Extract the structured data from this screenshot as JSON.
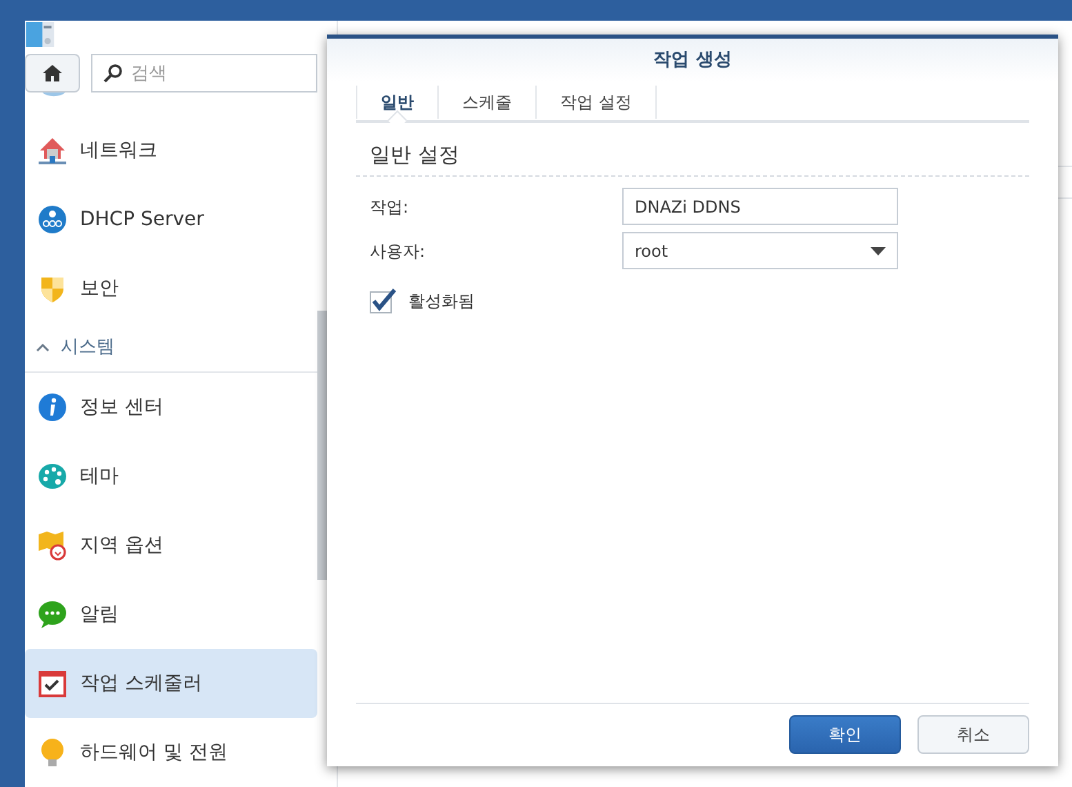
{
  "sidebar": {
    "search": {
      "placeholder": "검색"
    },
    "items": [
      {
        "kind": "item",
        "label": "네트워크",
        "selected": false
      },
      {
        "kind": "item",
        "label": "DHCP Server",
        "selected": false
      },
      {
        "kind": "item",
        "label": "보안",
        "selected": false
      },
      {
        "kind": "section",
        "label": "시스템",
        "expanded": true
      },
      {
        "kind": "item",
        "label": "정보 센터",
        "selected": false
      },
      {
        "kind": "item",
        "label": "테마",
        "selected": false
      },
      {
        "kind": "item",
        "label": "지역 옵션",
        "selected": false
      },
      {
        "kind": "item",
        "label": "알림",
        "selected": false
      },
      {
        "kind": "item",
        "label": "작업 스케줄러",
        "selected": true
      },
      {
        "kind": "item",
        "label": "하드웨어 및 전원",
        "selected": false
      }
    ]
  },
  "dialog": {
    "title": "작업 생성",
    "tabs": [
      {
        "label": "일반",
        "selected": true
      },
      {
        "label": "스케줄",
        "selected": false
      },
      {
        "label": "작업 설정",
        "selected": false
      }
    ],
    "section_title": "일반 설정",
    "fields": [
      {
        "kind": "text",
        "label": "작업:",
        "value": "DNAZi DDNS"
      },
      {
        "kind": "select",
        "label": "사용자:",
        "value": "root"
      }
    ],
    "checkbox": {
      "label": "활성화됨",
      "checked": true
    },
    "buttons": [
      {
        "kind": "primary",
        "label": "확인"
      },
      {
        "kind": "secondary",
        "label": "취소"
      }
    ]
  }
}
